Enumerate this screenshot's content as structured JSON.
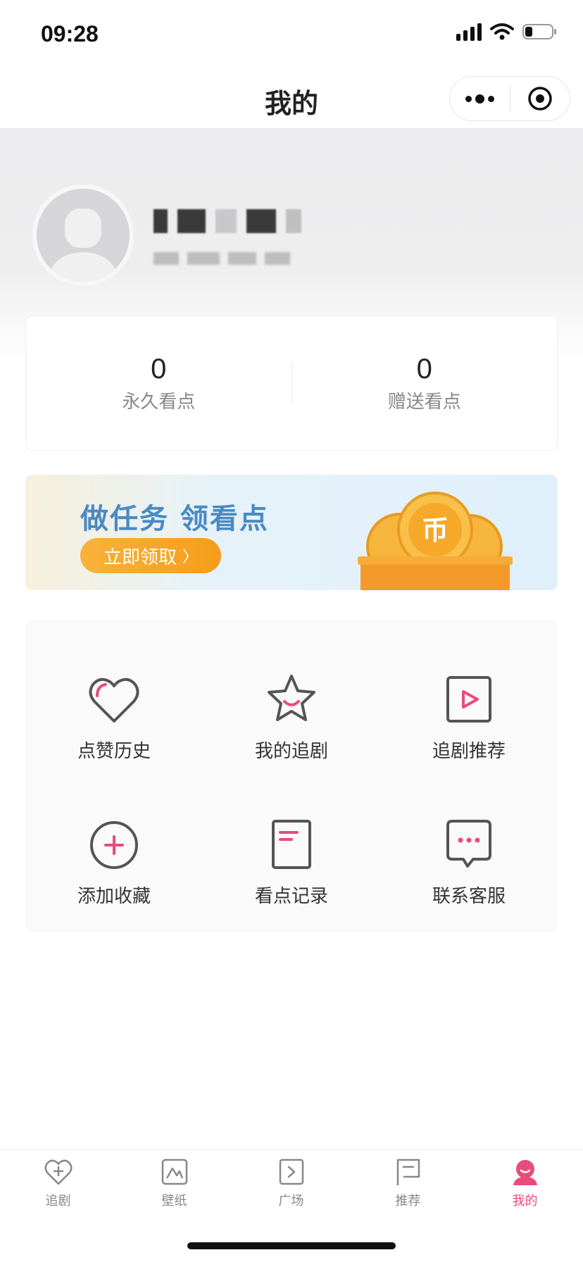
{
  "status_bar": {
    "time": "09:28"
  },
  "nav": {
    "title": "我的"
  },
  "points": {
    "permanent_value": "0",
    "permanent_label": "永久看点",
    "gift_value": "0",
    "gift_label": "赠送看点"
  },
  "banner": {
    "title": "做任务 领看点",
    "button_label": "立即领取",
    "button_arrow": "〉",
    "coin_glyph": "币"
  },
  "menu": {
    "items": [
      {
        "label": "点赞历史",
        "icon": "heart-icon"
      },
      {
        "label": "我的追剧",
        "icon": "star-icon"
      },
      {
        "label": "追剧推荐",
        "icon": "play-icon"
      },
      {
        "label": "添加收藏",
        "icon": "plus-circle-icon"
      },
      {
        "label": "看点记录",
        "icon": "document-icon"
      },
      {
        "label": "联系客服",
        "icon": "chat-icon"
      }
    ]
  },
  "tabs": {
    "items": [
      {
        "label": "追剧",
        "icon": "heart-plus-icon",
        "active": false
      },
      {
        "label": "壁纸",
        "icon": "image-icon",
        "active": false
      },
      {
        "label": "广场",
        "icon": "square-arrow-icon",
        "active": false
      },
      {
        "label": "推荐",
        "icon": "flag-icon",
        "active": false
      },
      {
        "label": "我的",
        "icon": "person-icon",
        "active": true
      }
    ]
  },
  "colors": {
    "accent": "#e94b7c",
    "banner_title": "#4a8ac4",
    "banner_button": "#f6a524",
    "icon_stroke": "#555555"
  }
}
